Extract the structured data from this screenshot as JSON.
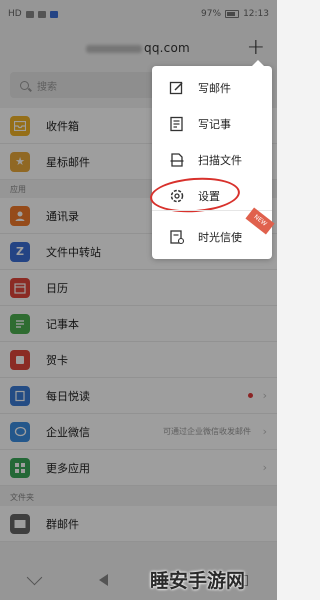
{
  "status_bar": {
    "left_indicators": "HD",
    "right_text": "97%",
    "time": "12:13"
  },
  "header": {
    "account_suffix": "qq.com",
    "add_label": "+"
  },
  "search": {
    "placeholder": "搜索"
  },
  "sections": {
    "apps_heading": "应用",
    "folders_heading": "文件夹"
  },
  "list": {
    "items": [
      {
        "label": "收件箱",
        "icon": "inbox-icon",
        "color": "#f0b429"
      },
      {
        "label": "星标邮件",
        "icon": "star-icon",
        "color": "#e8a83a"
      },
      {
        "label": "通讯录",
        "icon": "contacts-icon",
        "color": "#f07a2a"
      },
      {
        "label": "文件中转站",
        "icon": "transfer-icon",
        "color": "#3a6fd6"
      },
      {
        "label": "日历",
        "icon": "calendar-icon",
        "color": "#e0463a"
      },
      {
        "label": "记事本",
        "icon": "notebook-icon",
        "color": "#4caf50"
      },
      {
        "label": "贺卡",
        "icon": "card-icon",
        "color": "#e0463a"
      },
      {
        "label": "每日悦读",
        "icon": "reading-icon",
        "color": "#3a7bd5"
      },
      {
        "label": "企业微信",
        "icon": "wework-icon",
        "color": "#3a8de0",
        "hint": "可通过企业微信收发邮件"
      },
      {
        "label": "更多应用",
        "icon": "more-apps-icon",
        "color": "#3aa85a"
      },
      {
        "label": "群邮件",
        "icon": "group-mail-icon",
        "color": "#666666"
      }
    ]
  },
  "popup_menu": {
    "items": [
      {
        "label": "写邮件",
        "icon": "compose-icon"
      },
      {
        "label": "写记事",
        "icon": "note-icon"
      },
      {
        "label": "扫描文件",
        "icon": "scan-icon"
      },
      {
        "label": "设置",
        "icon": "gear-icon"
      },
      {
        "label": "时光信使",
        "icon": "time-letter-icon"
      }
    ],
    "badge": "NEW"
  },
  "watermark": "睡安手游网"
}
